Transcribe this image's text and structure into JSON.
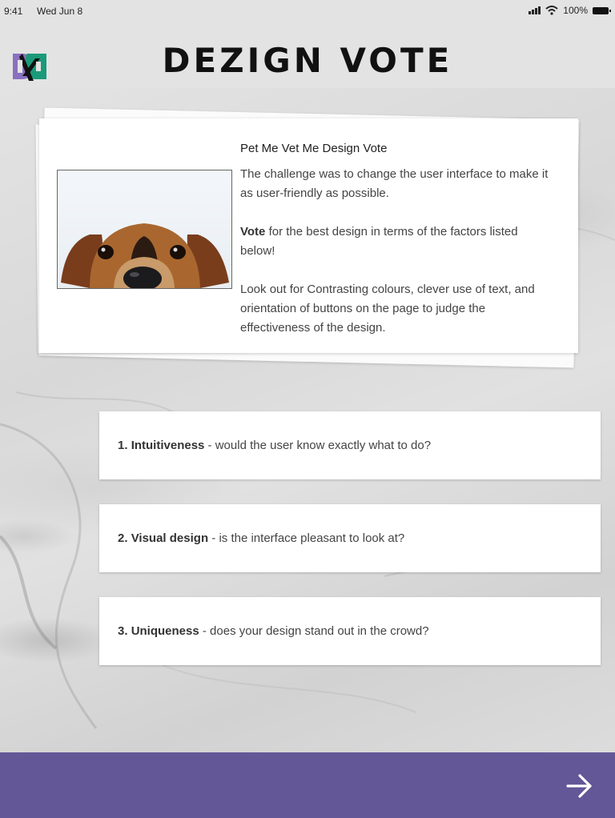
{
  "status_bar": {
    "time": "9:41",
    "date": "Wed Jun 8",
    "battery": "100%"
  },
  "header": {
    "title": "DEZIGN VOTE",
    "logo_icon": "dezign-logo-icon"
  },
  "intro_card": {
    "title": "Pet Me Vet Me Design Vote",
    "paragraph1": "The challenge was to change the user interface to make it as user-friendly as possible.",
    "vote_bold": "Vote",
    "paragraph2_rest": " for the best design in terms of the factors listed below!",
    "paragraph3": "Look out for Contrasting colours, clever use of text, and orientation of buttons on the page to judge the effectiveness of the design.",
    "image": "dog-photo"
  },
  "criteria": [
    {
      "number": "1.",
      "name": "Intuitiveness",
      "description": " - would the user know exactly what to do?"
    },
    {
      "number": "2.",
      "name": "Visual design",
      "description": " - is the interface pleasant to look at?"
    },
    {
      "number": "3.",
      "name": "Uniqueness",
      "description": " - does your design stand out in the crowd?"
    }
  ],
  "footer": {
    "next_icon": "arrow-right-icon"
  },
  "colors": {
    "footer": "#635797",
    "logo_purple": "#8b6fc0",
    "logo_green": "#1b9a7a"
  }
}
